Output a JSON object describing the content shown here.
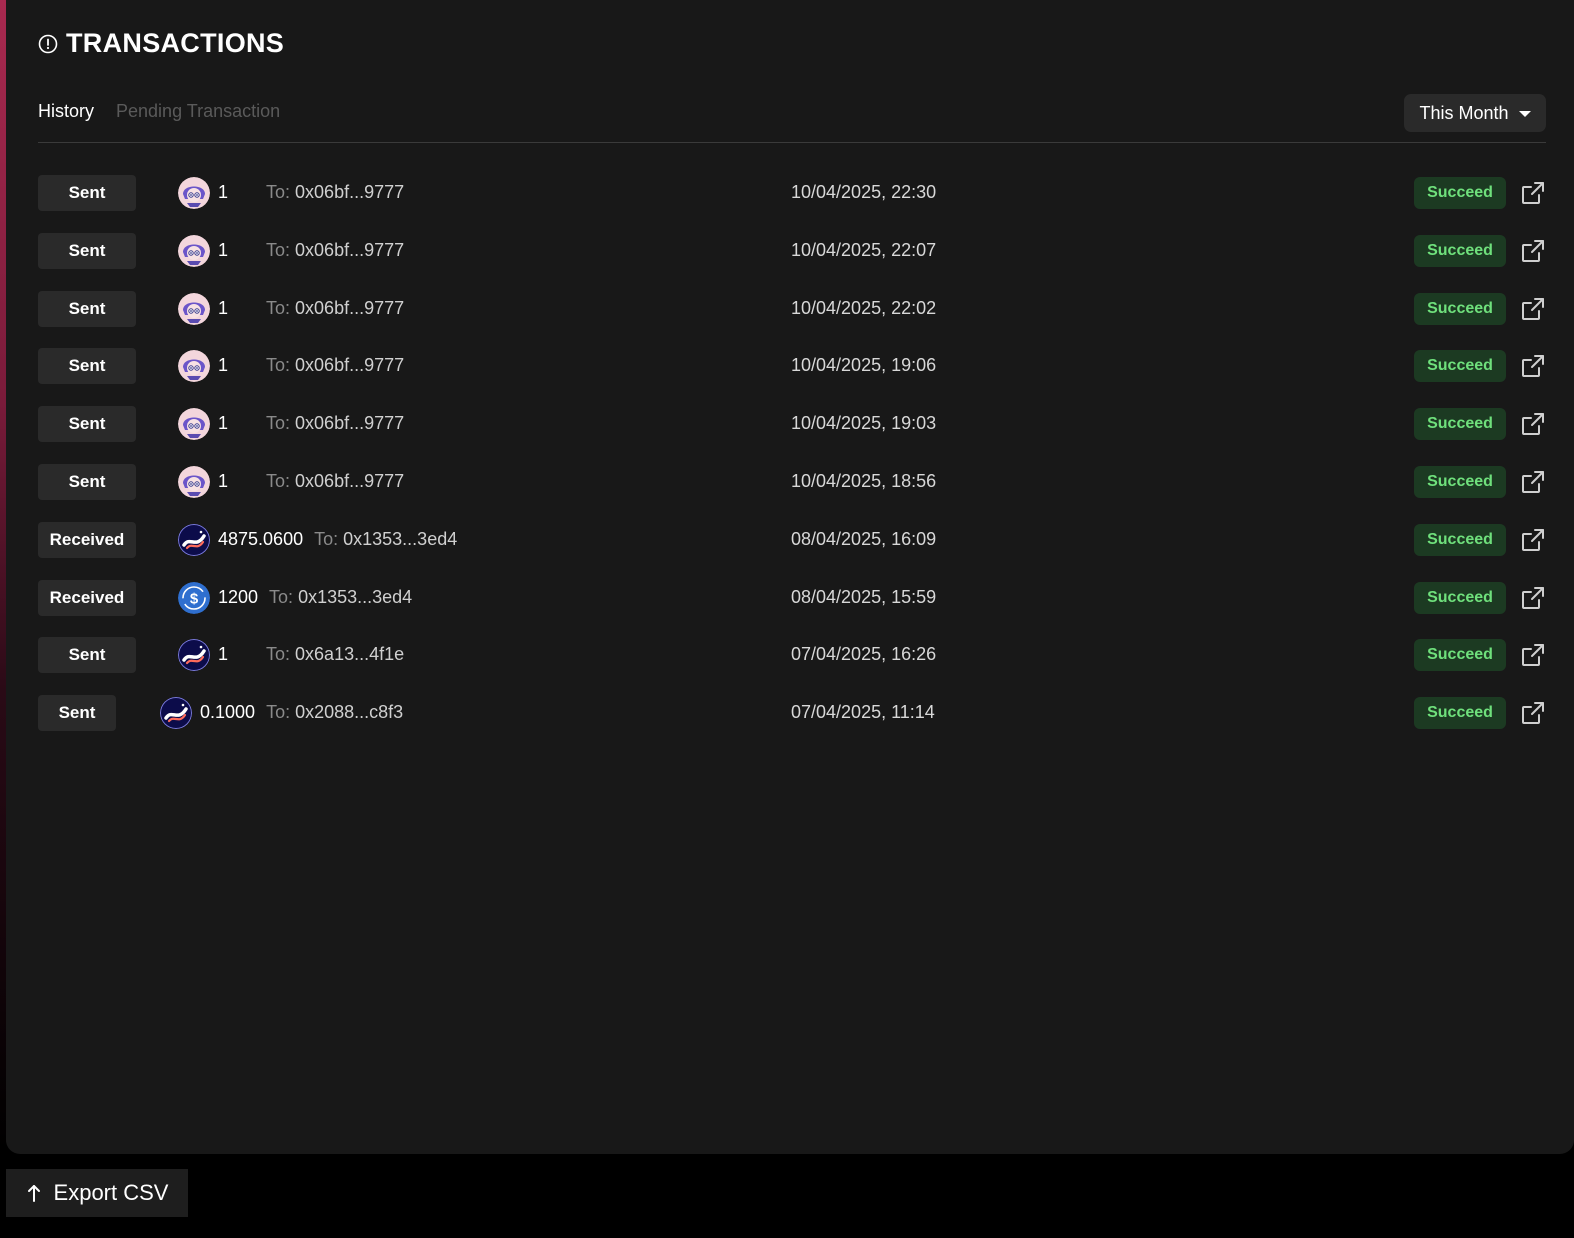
{
  "header": {
    "title": "TRANSACTIONS",
    "icon": "alert-circle-icon"
  },
  "tabs": [
    {
      "label": "History",
      "active": true
    },
    {
      "label": "Pending Transaction",
      "active": false
    }
  ],
  "period_filter": {
    "value": "This Month"
  },
  "transactions": [
    {
      "type": "Sent",
      "token_icon": "avatar-token-icon",
      "amount": "1",
      "to_label": "To:",
      "to_address": "0x06bf...9777",
      "date": "10/04/2025, 22:30",
      "status": "Succeed"
    },
    {
      "type": "Sent",
      "token_icon": "avatar-token-icon",
      "amount": "1",
      "to_label": "To:",
      "to_address": "0x06bf...9777",
      "date": "10/04/2025, 22:07",
      "status": "Succeed"
    },
    {
      "type": "Sent",
      "token_icon": "avatar-token-icon",
      "amount": "1",
      "to_label": "To:",
      "to_address": "0x06bf...9777",
      "date": "10/04/2025, 22:02",
      "status": "Succeed"
    },
    {
      "type": "Sent",
      "token_icon": "avatar-token-icon",
      "amount": "1",
      "to_label": "To:",
      "to_address": "0x06bf...9777",
      "date": "10/04/2025, 19:06",
      "status": "Succeed"
    },
    {
      "type": "Sent",
      "token_icon": "avatar-token-icon",
      "amount": "1",
      "to_label": "To:",
      "to_address": "0x06bf...9777",
      "date": "10/04/2025, 19:03",
      "status": "Succeed"
    },
    {
      "type": "Sent",
      "token_icon": "avatar-token-icon",
      "amount": "1",
      "to_label": "To:",
      "to_address": "0x06bf...9777",
      "date": "10/04/2025, 18:56",
      "status": "Succeed"
    },
    {
      "type": "Received",
      "token_icon": "wave-token-icon",
      "amount": "4875.0600",
      "to_label": "To:",
      "to_address": "0x1353...3ed4",
      "date": "08/04/2025, 16:09",
      "status": "Succeed"
    },
    {
      "type": "Received",
      "token_icon": "dollar-coin-icon",
      "amount": "1200",
      "to_label": "To:",
      "to_address": "0x1353...3ed4",
      "date": "08/04/2025, 15:59",
      "status": "Succeed"
    },
    {
      "type": "Sent",
      "token_icon": "wave-token-icon",
      "amount": "1",
      "to_label": "To:",
      "to_address": "0x6a13...4f1e",
      "date": "07/04/2025, 16:26",
      "status": "Succeed"
    },
    {
      "type": "Sent",
      "token_icon": "wave-token-icon",
      "amount": "0.1000",
      "to_label": "To:",
      "to_address": "0x2088...c8f3",
      "date": "07/04/2025, 11:14",
      "status": "Succeed"
    }
  ],
  "export": {
    "label": "Export CSV",
    "icon": "arrow-up-icon"
  },
  "colors": {
    "panel": "#181818",
    "badge": "#2a2a2a",
    "status_bg": "#1c3a22",
    "status_text": "#6fe07c"
  }
}
